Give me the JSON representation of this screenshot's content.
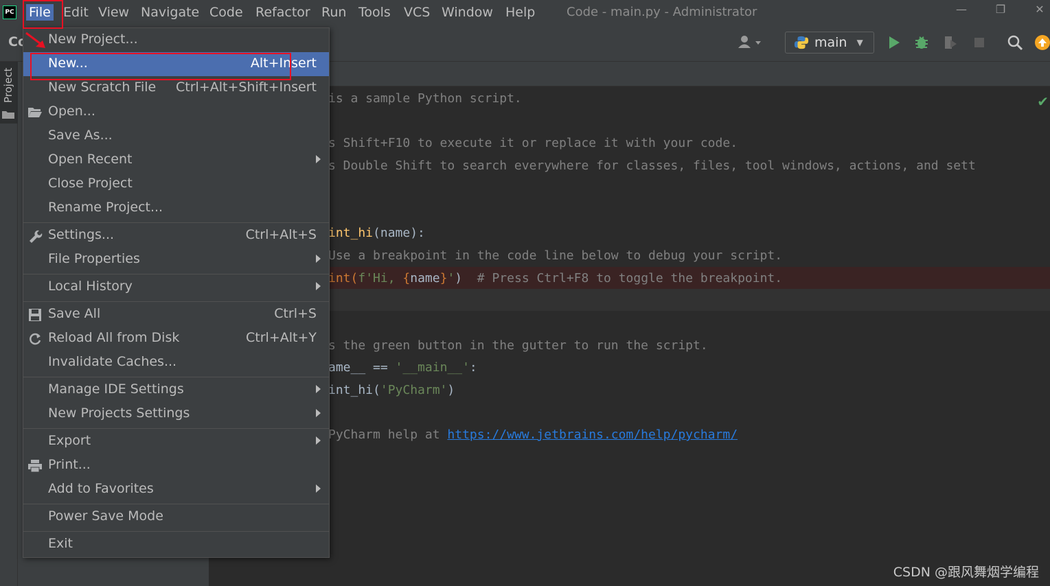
{
  "menubar": {
    "logo": "PC",
    "items": [
      "File",
      "Edit",
      "View",
      "Navigate",
      "Code",
      "Refactor",
      "Run",
      "Tools",
      "VCS",
      "Window",
      "Help"
    ],
    "title": "Code - main.py - Administrator"
  },
  "window_controls": {
    "minimize": "—",
    "restore": "❐",
    "close": "✕"
  },
  "toolbar": {
    "crumb": "Co",
    "run_config": "main"
  },
  "left_strip": {
    "project_tab": "Project"
  },
  "file_menu": {
    "items": [
      {
        "label": "New Project...",
        "shortcut": ""
      },
      {
        "label": "New...",
        "shortcut": "Alt+Insert"
      },
      {
        "label": "New Scratch File",
        "shortcut": "Ctrl+Alt+Shift+Insert"
      },
      {
        "label": "Open...",
        "shortcut": ""
      },
      {
        "label": "Save As...",
        "shortcut": ""
      },
      {
        "label": "Open Recent",
        "shortcut": ""
      },
      {
        "label": "Close Project",
        "shortcut": ""
      },
      {
        "label": "Rename Project...",
        "shortcut": ""
      },
      {
        "label": "Settings...",
        "shortcut": "Ctrl+Alt+S"
      },
      {
        "label": "File Properties",
        "shortcut": ""
      },
      {
        "label": "Local History",
        "shortcut": ""
      },
      {
        "label": "Save All",
        "shortcut": "Ctrl+S"
      },
      {
        "label": "Reload All from Disk",
        "shortcut": "Ctrl+Alt+Y"
      },
      {
        "label": "Invalidate Caches...",
        "shortcut": ""
      },
      {
        "label": "Manage IDE Settings",
        "shortcut": ""
      },
      {
        "label": "New Projects Settings",
        "shortcut": ""
      },
      {
        "label": "Export",
        "shortcut": ""
      },
      {
        "label": "Print...",
        "shortcut": ""
      },
      {
        "label": "Add to Favorites",
        "shortcut": ""
      },
      {
        "label": "Power Save Mode",
        "shortcut": ""
      },
      {
        "label": "Exit",
        "shortcut": ""
      }
    ]
  },
  "editor": {
    "lines": {
      "l1": "is a sample Python script.",
      "l2": "s Shift+F10 to execute it or replace it with your code.",
      "l3": "s Double Shift to search everywhere for classes, files, tool windows, actions, and sett",
      "l4_fn": "int_hi",
      "l4_rest": "(name):",
      "l5": "Use a breakpoint in the code line below to debug your script.",
      "l6_a": "int(",
      "l6_str1": "f'Hi, ",
      "l6_brace1": "{",
      "l6_name": "name",
      "l6_brace2": "}",
      "l6_str2": "'",
      "l6_b": ")  ",
      "l6_comment": "# Press Ctrl+F8 to toggle the breakpoint.",
      "l7": "s the green button in the gutter to run the script.",
      "l8_a": "ame__ == ",
      "l8_str": "'__main__'",
      "l8_b": ":",
      "l9_a": "int_hi(",
      "l9_str": "'PyCharm'",
      "l9_b": ")",
      "l10_a": "PyCharm help at ",
      "l10_link": "https://www.jetbrains.com/help/pycharm/"
    }
  },
  "watermark": "CSDN @跟风舞烟学编程",
  "colors": {
    "accent": "#4b6eaf",
    "annotation": "#e81123",
    "run_green": "#59a869"
  }
}
